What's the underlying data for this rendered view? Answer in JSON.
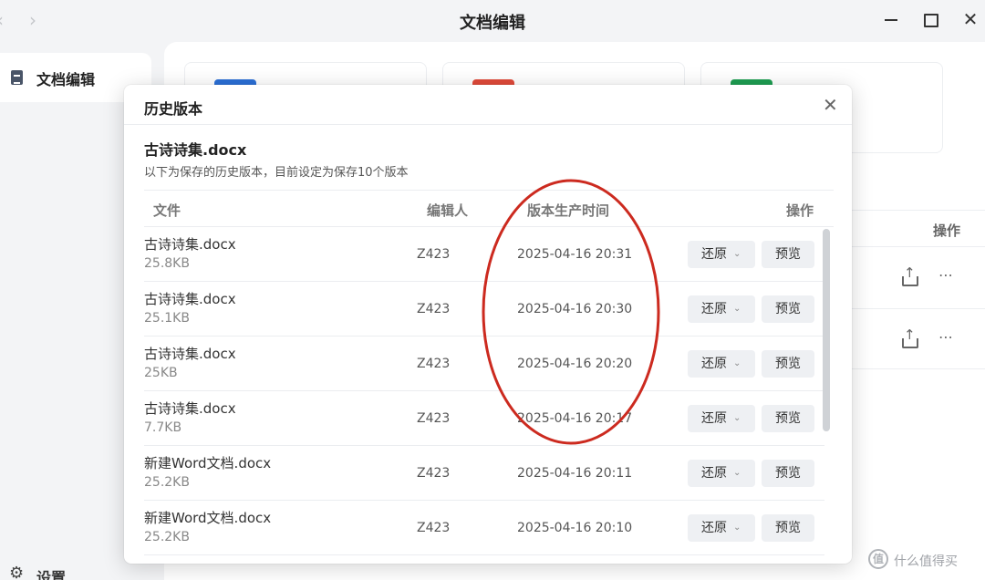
{
  "window": {
    "title": "文档编辑",
    "back_glyph": "‹",
    "forward_glyph": "›",
    "close_glyph": "✕"
  },
  "sidebar": {
    "items": [
      {
        "label": "文档编辑",
        "icon": "document-icon"
      }
    ],
    "settings": {
      "label": "设置",
      "icon": "gear-icon"
    }
  },
  "background": {
    "cards": [
      {
        "icon": "word-doc-icon",
        "color": "#2b6fd6"
      },
      {
        "icon": "ppt-doc-icon",
        "color": "#e04a3a"
      },
      {
        "icon": "excel-doc-icon",
        "color": "#1e9e52"
      }
    ],
    "actions_header": "操作",
    "more_glyph": "⋯"
  },
  "modal": {
    "title": "历史版本",
    "close_glyph": "✕",
    "file_name": "古诗诗集.docx",
    "description": "以下为保存的历史版本，目前设定为保存10个版本",
    "columns": {
      "file": "文件",
      "editor": "编辑人",
      "time": "版本生产时间",
      "actions": "操作"
    },
    "restore_label": "还原",
    "preview_label": "预览",
    "caret": "⌄",
    "rows": [
      {
        "name": "古诗诗集.docx",
        "size": "25.8KB",
        "editor": "Z423",
        "time": "2025-04-16 20:31"
      },
      {
        "name": "古诗诗集.docx",
        "size": "25.1KB",
        "editor": "Z423",
        "time": "2025-04-16 20:30"
      },
      {
        "name": "古诗诗集.docx",
        "size": "25KB",
        "editor": "Z423",
        "time": "2025-04-16 20:20"
      },
      {
        "name": "古诗诗集.docx",
        "size": "7.7KB",
        "editor": "Z423",
        "time": "2025-04-16 20:17"
      },
      {
        "name": "新建Word文档.docx",
        "size": "25.2KB",
        "editor": "Z423",
        "time": "2025-04-16 20:11"
      },
      {
        "name": "新建Word文档.docx",
        "size": "25.2KB",
        "editor": "Z423",
        "time": "2025-04-16 20:10"
      }
    ]
  },
  "annotation": {
    "color": "#cc2a1f"
  },
  "watermark": {
    "badge": "值",
    "text": "什么值得买"
  }
}
